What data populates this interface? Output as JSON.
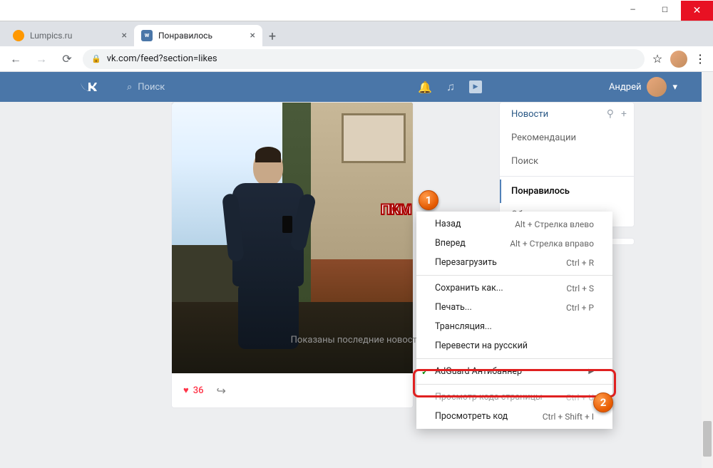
{
  "window": {
    "min": "—",
    "max": "☐",
    "close": "✕"
  },
  "tabs": [
    {
      "title": "Lumpics.ru"
    },
    {
      "title": "Понравилось",
      "active": true
    }
  ],
  "newtab_glyph": "+",
  "nav": {
    "back": "←",
    "forward": "→",
    "reload": "⟳",
    "lock": "🔒",
    "url": "vk.com/feed?section=likes",
    "star": "☆",
    "more": "⋮"
  },
  "vk": {
    "logo": "W",
    "search_icon": "⌕",
    "search_placeholder": "Поиск",
    "bell": "🔔",
    "music": "♫",
    "play": "▶",
    "user_name": "Андрей",
    "caret": "▾"
  },
  "post": {
    "like_icon": "♥",
    "like_count": "36",
    "share_icon": "↪"
  },
  "feed_end": "Показаны последние новости",
  "sidebar": {
    "filter": "⚲",
    "plus": "+",
    "items": [
      {
        "label": "Новости",
        "key": "news"
      },
      {
        "label": "Рекомендации",
        "key": "reco"
      },
      {
        "label": "Поиск",
        "key": "search"
      },
      {
        "label": "Понравилось",
        "key": "liked",
        "active": true
      },
      {
        "label": "Обновления",
        "key": "updates"
      }
    ]
  },
  "callout_pkm": "ПКМ",
  "badge1": "1",
  "badge2": "2",
  "ctx": {
    "back": {
      "label": "Назад",
      "sc": "Alt + Стрелка влево"
    },
    "fwd": {
      "label": "Вперед",
      "sc": "Alt + Стрелка вправо"
    },
    "reload": {
      "label": "Перезагрузить",
      "sc": "Ctrl + R"
    },
    "save": {
      "label": "Сохранить как...",
      "sc": "Ctrl + S"
    },
    "print": {
      "label": "Печать...",
      "sc": "Ctrl + P"
    },
    "cast": {
      "label": "Трансляция..."
    },
    "translate": {
      "label": "Перевести на русский"
    },
    "adguard": {
      "label": "AdGuard Антибаннер",
      "check": "✓",
      "arrow": "▶"
    },
    "source": {
      "label": "Просмотр кода страницы",
      "sc": "Ctrl + U"
    },
    "inspect": {
      "label": "Просмотреть код",
      "sc": "Ctrl + Shift + I"
    }
  }
}
